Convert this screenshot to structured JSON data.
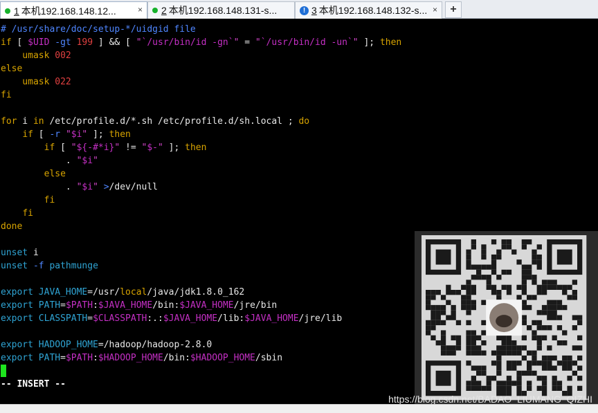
{
  "tabs": [
    {
      "num": "1",
      "title": "本机192.168.148.12...",
      "status": "connected",
      "active": true
    },
    {
      "num": "2",
      "title": "本机192.168.148.131-s...",
      "status": "connected",
      "active": false
    },
    {
      "num": "3",
      "title": "本机192.168.148.132-s...",
      "status": "warning",
      "active": false
    }
  ],
  "tab_close_glyph": "×",
  "add_tab_glyph": "+",
  "editor": {
    "lines": [
      [
        [
          "# /usr/share/doc/setup-*/uidgid file",
          "cm"
        ]
      ],
      [
        [
          "if",
          "kw"
        ],
        [
          " [ ",
          "plain"
        ],
        [
          "$UID",
          "var"
        ],
        [
          " -gt ",
          "op"
        ],
        [
          "199",
          "num"
        ],
        [
          " ] ",
          "plain"
        ],
        [
          "&&",
          "plain"
        ],
        [
          " [ ",
          "plain"
        ],
        [
          "\"",
          "str"
        ],
        [
          "`/usr/bin/id -gn`",
          "var"
        ],
        [
          "\"",
          "str"
        ],
        [
          " = ",
          "plain"
        ],
        [
          "\"",
          "str"
        ],
        [
          "`/usr/bin/id -un`",
          "var"
        ],
        [
          "\"",
          "str"
        ],
        [
          " ]; ",
          "plain"
        ],
        [
          "then",
          "kw"
        ]
      ],
      [
        [
          "    umask ",
          "kw"
        ],
        [
          "002",
          "num"
        ]
      ],
      [
        [
          "else",
          "kw"
        ]
      ],
      [
        [
          "    umask ",
          "kw"
        ],
        [
          "022",
          "num"
        ]
      ],
      [
        [
          "fi",
          "kw"
        ]
      ],
      [
        [
          "",
          "plain"
        ]
      ],
      [
        [
          "for",
          "kw"
        ],
        [
          " i ",
          "plain"
        ],
        [
          "in",
          "kw"
        ],
        [
          " /etc/profile.d/*.sh /etc/profile.d/sh.local ; ",
          "plain"
        ],
        [
          "do",
          "kw"
        ]
      ],
      [
        [
          "    ",
          "plain"
        ],
        [
          "if",
          "kw"
        ],
        [
          " [ ",
          "plain"
        ],
        [
          "-r",
          "op"
        ],
        [
          " ",
          "plain"
        ],
        [
          "\"",
          "str"
        ],
        [
          "$i",
          "var"
        ],
        [
          "\"",
          "str"
        ],
        [
          " ]; ",
          "plain"
        ],
        [
          "then",
          "kw"
        ]
      ],
      [
        [
          "        ",
          "plain"
        ],
        [
          "if",
          "kw"
        ],
        [
          " [ ",
          "plain"
        ],
        [
          "\"",
          "str"
        ],
        [
          "${-#*i}",
          "var"
        ],
        [
          "\"",
          "str"
        ],
        [
          " != ",
          "plain"
        ],
        [
          "\"",
          "str"
        ],
        [
          "$-",
          "var"
        ],
        [
          "\"",
          "str"
        ],
        [
          " ]; ",
          "plain"
        ],
        [
          "then",
          "kw"
        ]
      ],
      [
        [
          "            . ",
          "plain"
        ],
        [
          "\"",
          "str"
        ],
        [
          "$i",
          "var"
        ],
        [
          "\"",
          "str"
        ]
      ],
      [
        [
          "        ",
          "plain"
        ],
        [
          "else",
          "kw"
        ]
      ],
      [
        [
          "            . ",
          "plain"
        ],
        [
          "\"",
          "str"
        ],
        [
          "$i",
          "var"
        ],
        [
          "\"",
          "str"
        ],
        [
          " ",
          "plain"
        ],
        [
          ">",
          "op"
        ],
        [
          "/dev/null",
          "plain"
        ]
      ],
      [
        [
          "        ",
          "plain"
        ],
        [
          "fi",
          "kw"
        ]
      ],
      [
        [
          "    ",
          "plain"
        ],
        [
          "fi",
          "kw"
        ]
      ],
      [
        [
          "done",
          "kw"
        ]
      ],
      [
        [
          "",
          "plain"
        ]
      ],
      [
        [
          "unset",
          "cmd"
        ],
        [
          " i",
          "plain"
        ]
      ],
      [
        [
          "unset",
          "cmd"
        ],
        [
          " ",
          "plain"
        ],
        [
          "-f",
          "op"
        ],
        [
          " pathmunge",
          "cmd"
        ]
      ],
      [
        [
          "",
          "plain"
        ]
      ],
      [
        [
          "export",
          "cmd"
        ],
        [
          " JAVA_HOME",
          "cmd"
        ],
        [
          "=/usr/",
          "plain"
        ],
        [
          "local",
          "kw"
        ],
        [
          "/java/jdk1.8.0_162",
          "plain"
        ]
      ],
      [
        [
          "export",
          "cmd"
        ],
        [
          " PATH",
          "cmd"
        ],
        [
          "=",
          "plain"
        ],
        [
          "$PATH",
          "var"
        ],
        [
          ":",
          "plain"
        ],
        [
          "$JAVA_HOME",
          "var"
        ],
        [
          "/bin:",
          "plain"
        ],
        [
          "$JAVA_HOME",
          "var"
        ],
        [
          "/jre/bin",
          "plain"
        ]
      ],
      [
        [
          "export",
          "cmd"
        ],
        [
          " CLASSPATH",
          "cmd"
        ],
        [
          "=",
          "plain"
        ],
        [
          "$CLASSPATH",
          "var"
        ],
        [
          ":.:",
          "plain"
        ],
        [
          "$JAVA_HOME",
          "var"
        ],
        [
          "/lib:",
          "plain"
        ],
        [
          "$JAVA_HOME",
          "var"
        ],
        [
          "/jre/lib",
          "plain"
        ]
      ],
      [
        [
          "",
          "plain"
        ]
      ],
      [
        [
          "export",
          "cmd"
        ],
        [
          " HADOOP_HOME",
          "cmd"
        ],
        [
          "=/hadoop/hadoop-2.8.0",
          "plain"
        ]
      ],
      [
        [
          "export",
          "cmd"
        ],
        [
          " PATH",
          "cmd"
        ],
        [
          "=",
          "plain"
        ],
        [
          "$PATH",
          "var"
        ],
        [
          ":",
          "plain"
        ],
        [
          "$HADOOP_HOME",
          "var"
        ],
        [
          "/bin:",
          "plain"
        ],
        [
          "$HADOOP_HOME",
          "var"
        ],
        [
          "/sbin",
          "plain"
        ]
      ]
    ],
    "mode_line": "-- INSERT --"
  },
  "watermark": "https://blog.csdn.net/BADAO_LIUMANG_QIZHI",
  "qr": {
    "icon": "qr-code-with-avatar"
  },
  "colors": {
    "background": "#000000",
    "comment": "#4f86ff",
    "keyword": "#d8a400",
    "number": "#e04040",
    "string": "#d146c8",
    "variable": "#c42fc4",
    "command": "#2fa4d4",
    "cursor": "#1ee51e",
    "connected": "#17b12b",
    "warning": "#1f6fd6"
  }
}
